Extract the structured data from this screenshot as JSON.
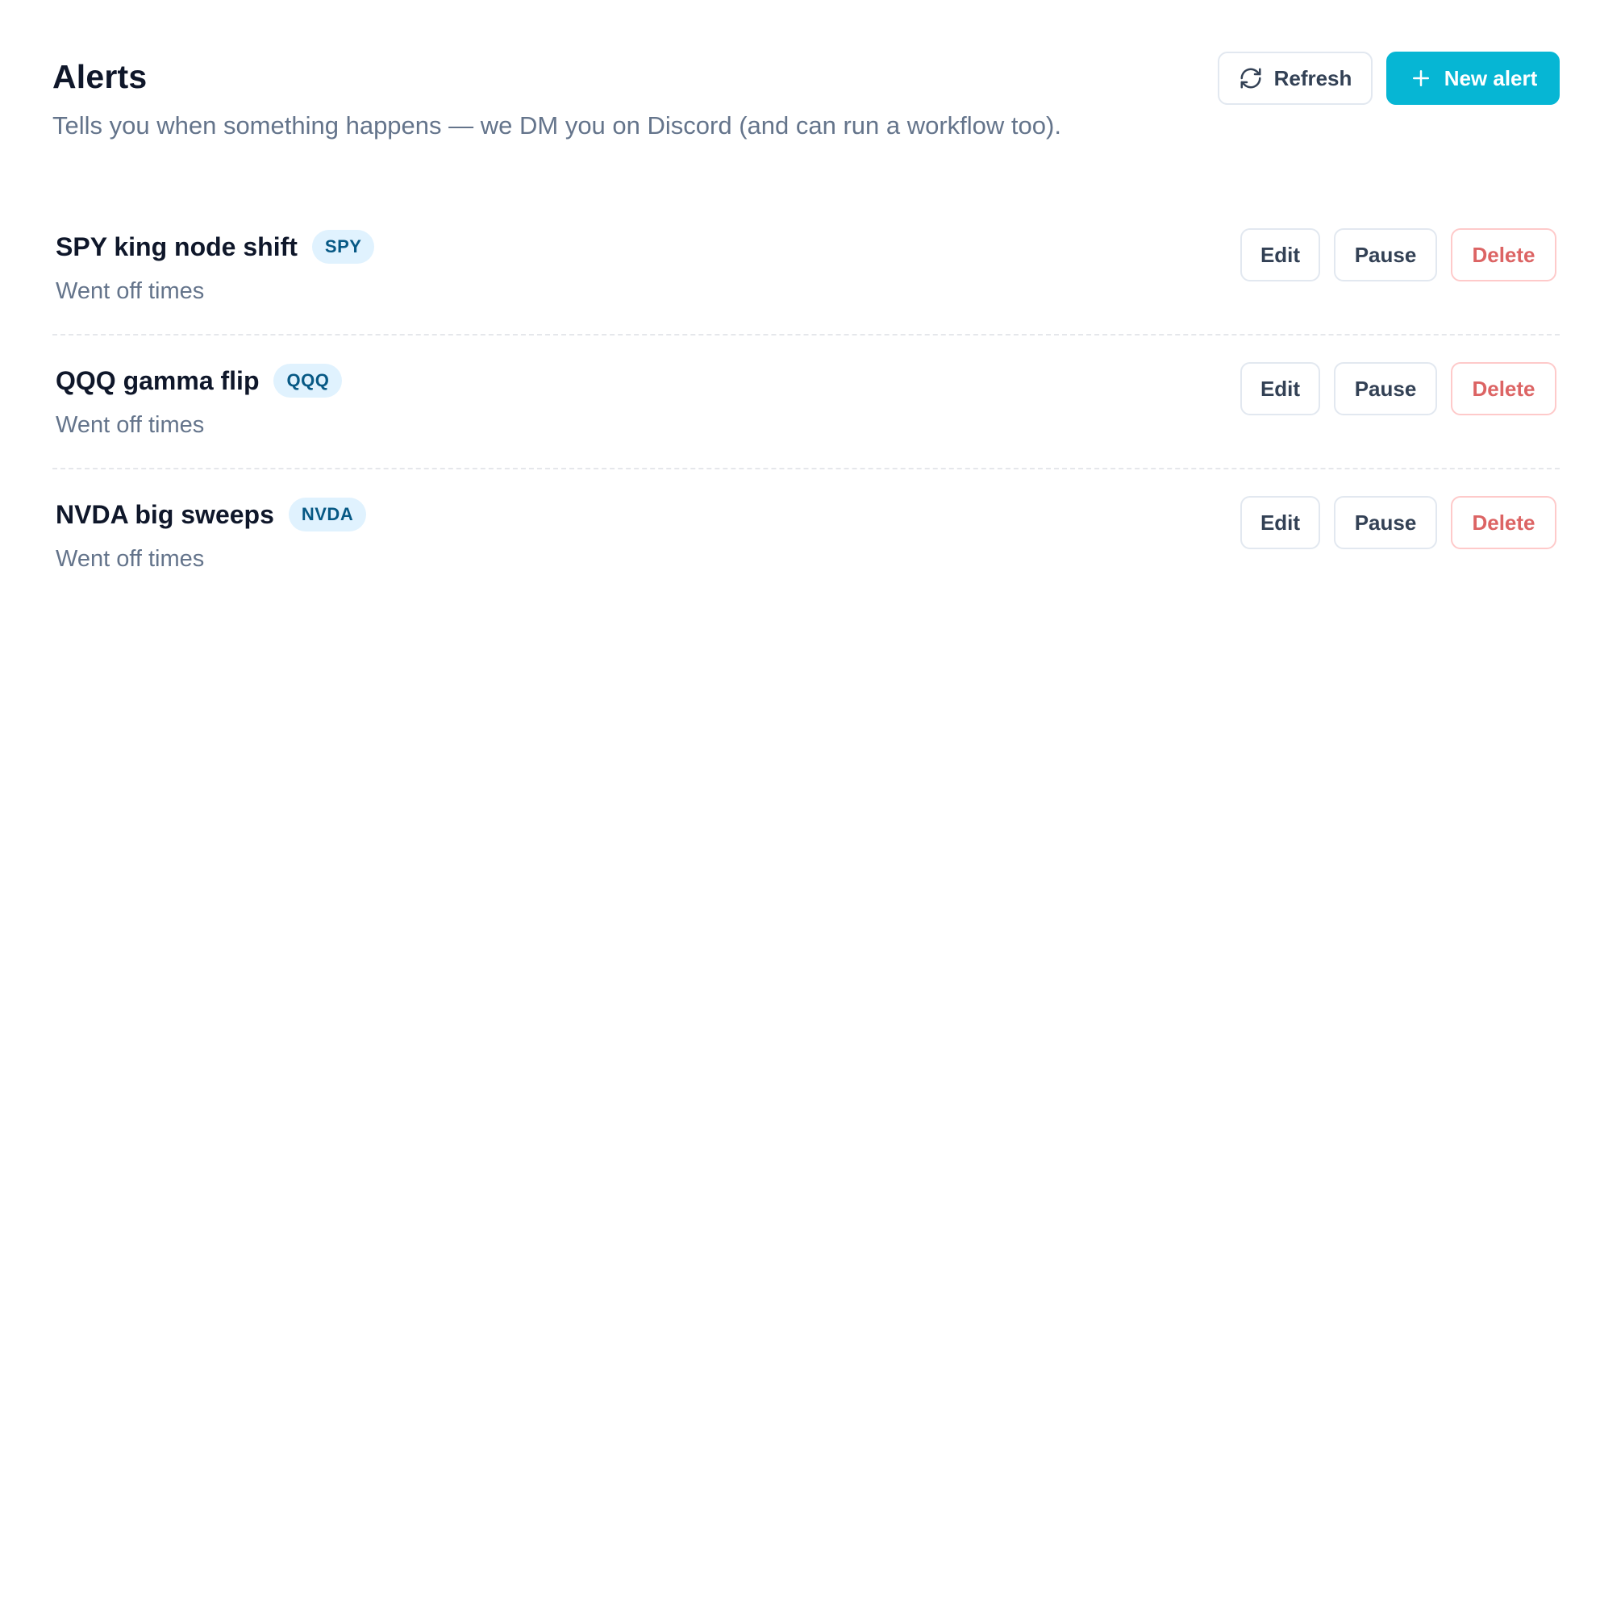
{
  "header": {
    "title": "Alerts",
    "subtitle": "Tells you when something happens — we DM you on Discord (and can run a workflow too).",
    "refresh_label": "Refresh",
    "refresh_icon": "refresh-icon",
    "new_alert_label": "New alert",
    "new_alert_icon": "plus-icon"
  },
  "alerts": [
    {
      "name": "SPY king node shift",
      "ticker": "SPY",
      "subtitle": "Went off times",
      "edit_label": "Edit",
      "pause_label": "Pause",
      "delete_label": "Delete"
    },
    {
      "name": "QQQ gamma flip",
      "ticker": "QQQ",
      "subtitle": "Went off times",
      "edit_label": "Edit",
      "pause_label": "Pause",
      "delete_label": "Delete"
    },
    {
      "name": "NVDA big sweeps",
      "ticker": "NVDA",
      "subtitle": "Went off times",
      "edit_label": "Edit",
      "pause_label": "Pause",
      "delete_label": "Delete"
    }
  ],
  "colors": {
    "accent": "#06b6d4",
    "badge_bg": "#e0f2fe",
    "badge_text": "#075985",
    "danger": "#dc6464",
    "danger_border": "#fecaca",
    "muted_text": "#64748b"
  }
}
